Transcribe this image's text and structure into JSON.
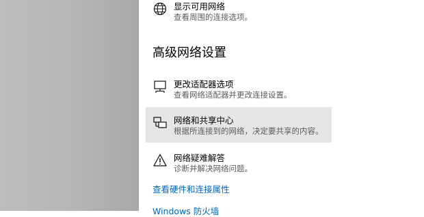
{
  "top_item": {
    "title": "显示可用网络",
    "desc": "查看周围的连接选项。",
    "icon": "globe-icon"
  },
  "section": {
    "heading": "高级网络设置"
  },
  "items": [
    {
      "title": "更改适配器选项",
      "desc": "查看网络适配器并更改连接设置。",
      "icon": "adapter-monitor-icon"
    },
    {
      "title": "网络和共享中心",
      "desc": "根据所连接到的网络，决定要共享的内容。",
      "icon": "sharing-center-icon"
    },
    {
      "title": "网络疑难解答",
      "desc": "诊断并解决网络问题。",
      "icon": "warning-icon"
    }
  ],
  "links": {
    "hardware": "查看硬件和连接属性",
    "firewall": "Windows 防火墙"
  },
  "colors": {
    "link": "#0067c0",
    "hover_bg": "#e6e6e6",
    "secondary_text": "#5c5c5c"
  }
}
